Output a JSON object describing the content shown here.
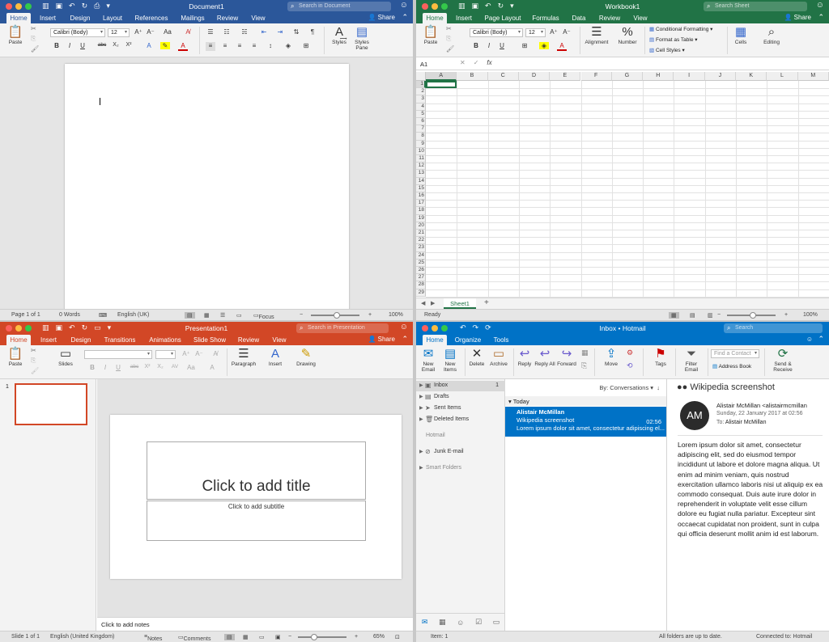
{
  "word": {
    "title": "Document1",
    "search_placeholder": "Search in Document",
    "share": "Share",
    "tabs": [
      "Home",
      "Insert",
      "Design",
      "Layout",
      "References",
      "Mailings",
      "Review",
      "View"
    ],
    "ribbon": {
      "paste": "Paste",
      "font": "Calibri (Body)",
      "size": "12",
      "styles": "Styles",
      "styles_pane": "Styles Pane"
    },
    "status": {
      "page": "Page 1 of 1",
      "words": "0 Words",
      "lang": "English (UK)",
      "focus": "Focus",
      "zoom": "100%"
    },
    "zoom_level": 100
  },
  "excel": {
    "title": "Workbook1",
    "search_placeholder": "Search Sheet",
    "share": "Share",
    "tabs": [
      "Home",
      "Insert",
      "Page Layout",
      "Formulas",
      "Data",
      "Review",
      "View"
    ],
    "ribbon": {
      "paste": "Paste",
      "font": "Calibri (Body)",
      "size": "12",
      "alignment": "Alignment",
      "number": "Number",
      "cond_format": "Conditional Formatting",
      "format_table": "Format as Table",
      "cell_styles": "Cell Styles",
      "cells": "Cells",
      "editing": "Editing"
    },
    "name_box": "A1",
    "fx": "fx",
    "columns": [
      "A",
      "B",
      "C",
      "D",
      "E",
      "F",
      "G",
      "H",
      "I",
      "J",
      "K",
      "L",
      "M"
    ],
    "rows": [
      "1",
      "2",
      "3",
      "4",
      "5",
      "6",
      "7",
      "8",
      "9",
      "10",
      "11",
      "12",
      "13",
      "14",
      "15",
      "16",
      "17",
      "18",
      "19",
      "20",
      "21",
      "22",
      "23",
      "24",
      "25",
      "26",
      "27",
      "28",
      "29"
    ],
    "sheet_tab": "Sheet1",
    "status": {
      "ready": "Ready",
      "zoom": "100%"
    }
  },
  "ppt": {
    "title": "Presentation1",
    "search_placeholder": "Search in Presentation",
    "share": "Share",
    "tabs": [
      "Home",
      "Insert",
      "Design",
      "Transitions",
      "Animations",
      "Slide Show",
      "Review",
      "View"
    ],
    "ribbon": {
      "paste": "Paste",
      "slides": "Slides",
      "paragraph": "Paragraph",
      "insert": "Insert",
      "drawing": "Drawing"
    },
    "slide_number": "1",
    "title_placeholder": "Click to add title",
    "subtitle_placeholder": "Click to add subtitle",
    "notes_placeholder": "Click to add notes",
    "status": {
      "slide": "Slide 1 of 1",
      "lang": "English (United Kingdom)",
      "notes": "Notes",
      "comments": "Comments",
      "zoom": "65%"
    }
  },
  "outlook": {
    "title": "Inbox • Hotmail",
    "search_placeholder": "Search",
    "tabs": [
      "Home",
      "Organize",
      "Tools"
    ],
    "ribbon": {
      "new_email": "New Email",
      "new_items": "New Items",
      "delete": "Delete",
      "archive": "Archive",
      "reply": "Reply",
      "reply_all": "Reply All",
      "forward": "Forward",
      "move": "Move",
      "tags": "Tags",
      "filter_email": "Filter Email",
      "find_contact": "Find a Contact",
      "address_book": "Address Book",
      "send_receive": "Send & Receive"
    },
    "folders": [
      {
        "label": "Inbox",
        "count": "1"
      },
      {
        "label": "Drafts",
        "count": ""
      },
      {
        "label": "Sent Items",
        "count": ""
      },
      {
        "label": "Deleted Items",
        "count": ""
      }
    ],
    "account_hotmail": "Hotmail",
    "junk": "Junk E-mail",
    "smart_folders": "Smart Folders",
    "sort": "By: Conversations",
    "group_today": "Today",
    "message": {
      "sender": "Alistair McMillan",
      "subject": "Wikipedia screenshot",
      "time": "02:56",
      "preview": "Lorem ipsum dolor sit amet, consectetur adipiscing el..."
    },
    "reading": {
      "subject": "Wikipedia screenshot",
      "initials": "AM",
      "from": "Alistair McMillan <alistairmcmillan",
      "date": "Sunday, 22 January 2017 at 02:56",
      "to_label": "To:",
      "to": "Alistair McMillan",
      "body": "Lorem ipsum dolor sit amet, consectetur adipiscing elit, sed do eiusmod tempor incididunt ut labore et dolore magna aliqua. Ut enim ad minim veniam, quis nostrud exercitation ullamco laboris nisi ut aliquip ex ea commodo consequat. Duis aute irure dolor in reprehenderit in voluptate velit esse cillum dolore eu fugiat nulla pariatur. Excepteur sint occaecat cupidatat non proident, sunt in culpa qui officia deserunt mollit anim id est laborum."
    },
    "status": {
      "items": "Item: 1",
      "sync": "All folders are up to date.",
      "connected": "Connected to: Hotmail"
    }
  },
  "icons": {
    "search": "🔍",
    "smiley": "☺",
    "share": "👤+"
  }
}
